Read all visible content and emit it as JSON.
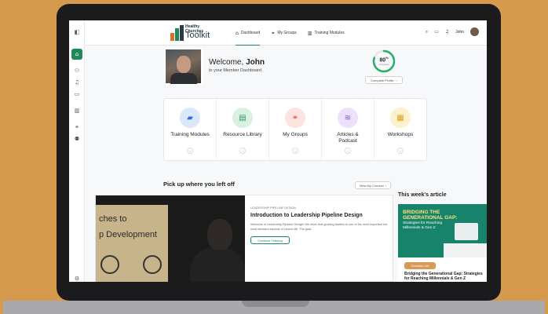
{
  "colors": {
    "accent": "#1e8a57",
    "background": "#d69a4f",
    "article_bg": "#17836a",
    "tag": "#d99a55"
  },
  "sidebar": {
    "icons": [
      {
        "name": "menu-toggle-icon",
        "glyph": "◧"
      },
      {
        "name": "home-icon",
        "glyph": "⌂"
      },
      {
        "name": "user-icon",
        "glyph": "⚇"
      },
      {
        "name": "bell-icon",
        "glyph": "♫"
      },
      {
        "name": "inbox-icon",
        "glyph": "▭"
      },
      {
        "name": "book-icon",
        "glyph": "▥"
      },
      {
        "name": "group-icon",
        "glyph": "⚭"
      },
      {
        "name": "profile-icon",
        "glyph": "⚉"
      },
      {
        "name": "settings-icon",
        "glyph": "⚙"
      }
    ]
  },
  "header": {
    "logo_small": "Healthy\nChurches",
    "logo_big": "Toolkit",
    "nav": [
      {
        "label": "Dashboard",
        "icon": "⌂"
      },
      {
        "label": "My Groups",
        "icon": "⚭"
      },
      {
        "label": "Training Modules",
        "icon": "▥"
      }
    ],
    "search_icon": "⌕",
    "inbox_icon": "▭",
    "bell_icon": "♫",
    "user_name": "John"
  },
  "welcome": {
    "greeting": "Welcome, ",
    "name": "John",
    "subtitle": "to your Member Dashboard",
    "progress": 80,
    "progress_label": "80",
    "progress_unit": "%",
    "progress_caption": "Complete",
    "complete_button": "Complete Profile",
    "chevron": "›"
  },
  "cards": [
    {
      "label": "Training Modules",
      "icon": "▰",
      "bg": "#dbe8fb",
      "fg": "#2f6fd6"
    },
    {
      "label": "Resource Library",
      "icon": "▤",
      "bg": "#d9f0e2",
      "fg": "#2e9a5a"
    },
    {
      "label": "My Groups",
      "icon": "⚭",
      "bg": "#fde3df",
      "fg": "#e0604f"
    },
    {
      "label": "Articles & Podcast",
      "icon": "≋",
      "bg": "#ece1fb",
      "fg": "#8b4fe0"
    },
    {
      "label": "Workshops",
      "icon": "▦",
      "bg": "#fdf1cf",
      "fg": "#d9a21a"
    }
  ],
  "continue": {
    "title": "Pick up where you left off",
    "view_button": "View My Courses",
    "course": {
      "slide_lines": [
        "ches to",
        "p Development"
      ],
      "category": "LEADERSHIP PIPELINE DESIGN",
      "title": "Introduction to Leadership Pipeline Design",
      "description": "Welcome to Leadership Pipeline Design! We know that growing leaders is one of the most important but most stressful aspects of church life. The goal...",
      "button": "Continue Training"
    }
  },
  "article": {
    "heading": "This week's article",
    "img_title": "BRIDGING THE GENERATIONAL GAP:",
    "img_subtitle": "Strategies for Reaching Millennials & Gen Z",
    "tag": "Christian Life",
    "title": "Bridging the Generational Gap: Strategies for Reaching Millennials & Gen Z"
  }
}
